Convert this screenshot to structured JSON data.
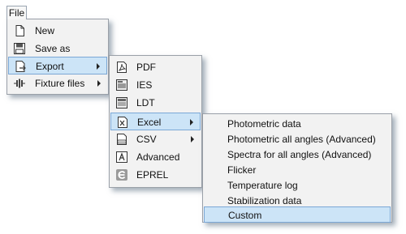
{
  "file_tab": "File",
  "file_menu": {
    "items": [
      {
        "label": "New",
        "icon": "new-document-icon"
      },
      {
        "label": "Save as",
        "icon": "save-icon"
      },
      {
        "label": "Export",
        "icon": "export-icon",
        "has_submenu": true
      },
      {
        "label": "Fixture files",
        "icon": "fixture-icon",
        "has_submenu": true
      }
    ]
  },
  "export_menu": {
    "items": [
      {
        "label": "PDF",
        "icon": "pdf-icon"
      },
      {
        "label": "IES",
        "icon": "ies-icon"
      },
      {
        "label": "LDT",
        "icon": "ldt-icon"
      },
      {
        "label": "Excel",
        "icon": "excel-icon",
        "has_submenu": true
      },
      {
        "label": "CSV",
        "icon": "csv-icon",
        "has_submenu": true
      },
      {
        "label": "Advanced",
        "icon": "advanced-icon"
      },
      {
        "label": "EPREL",
        "icon": "eprel-icon"
      }
    ]
  },
  "excel_menu": {
    "items": [
      {
        "label": "Photometric data"
      },
      {
        "label": "Photometric all angles (Advanced)"
      },
      {
        "label": "Spectra for all angles (Advanced)"
      },
      {
        "label": "Flicker"
      },
      {
        "label": "Temperature log"
      },
      {
        "label": "Stabilization data"
      },
      {
        "label": "Custom"
      }
    ]
  },
  "colors": {
    "highlight_bg": "#cce4f7",
    "highlight_border": "#7ba7d6",
    "menu_bg": "#f2f2f2"
  }
}
